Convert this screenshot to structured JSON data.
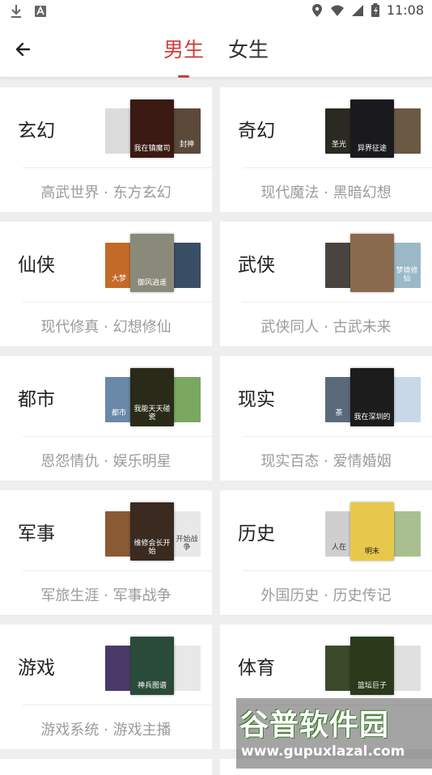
{
  "status_bar": {
    "time": "11:08",
    "left_icons": [
      "download-icon",
      "font-a-icon"
    ],
    "right_icons": [
      "location-icon",
      "wifi-icon",
      "signal-icon",
      "battery-icon"
    ]
  },
  "header": {
    "back_icon": "arrow-left-icon",
    "tabs": [
      {
        "label": "男生",
        "active": true
      },
      {
        "label": "女生",
        "active": false
      }
    ]
  },
  "colors": {
    "accent": "#d23c3c",
    "tag_text": "#9b9b9b",
    "background": "#eeeeee"
  },
  "categories": [
    {
      "name": "玄幻",
      "tags": "高武世界 · 东方玄幻",
      "covers": [
        {
          "text": "",
          "bg": "#dcdcdc"
        },
        {
          "text": "我在镇魔司",
          "bg": "#3a1a12"
        },
        {
          "text": "封神",
          "bg": "#5b4a3a"
        }
      ]
    },
    {
      "name": "奇幻",
      "tags": "现代魔法 · 黑暗幻想",
      "covers": [
        {
          "text": "圣光",
          "bg": "#2b2a22"
        },
        {
          "text": "异界征途",
          "bg": "#1a1a1e"
        },
        {
          "text": "",
          "bg": "#6a5a44"
        }
      ]
    },
    {
      "name": "仙侠",
      "tags": "现代修真 · 幻想修仙",
      "covers": [
        {
          "text": "大梦",
          "bg": "#c46a28"
        },
        {
          "text": "御风逍遥",
          "bg": "#8a8a7a"
        },
        {
          "text": "",
          "bg": "#3a4e66"
        }
      ]
    },
    {
      "name": "武侠",
      "tags": "武侠同人 · 古武未来",
      "covers": [
        {
          "text": "",
          "bg": "#4a4440"
        },
        {
          "text": "",
          "bg": "#8a6a4c"
        },
        {
          "text": "梦境修仙",
          "bg": "#9ab8c8"
        }
      ]
    },
    {
      "name": "都市",
      "tags": "恩怨情仇 · 娱乐明星",
      "covers": [
        {
          "text": "都市",
          "bg": "#6a88a8"
        },
        {
          "text": "我能天天碰瓷",
          "bg": "#2a2a18"
        },
        {
          "text": "",
          "bg": "#7aa860"
        }
      ]
    },
    {
      "name": "现实",
      "tags": "现实百态 · 爱情婚姻",
      "covers": [
        {
          "text": "茶",
          "bg": "#5a6a7a"
        },
        {
          "text": "我在深圳的",
          "bg": "#1c1c1c"
        },
        {
          "text": "",
          "bg": "#c8d8e8"
        }
      ]
    },
    {
      "name": "军事",
      "tags": "军旅生涯 · 军事战争",
      "covers": [
        {
          "text": "",
          "bg": "#8a5a34"
        },
        {
          "text": "维修会长开始",
          "bg": "#3a2a20"
        },
        {
          "text": "开始战争",
          "bg": "#e8e8e8"
        }
      ]
    },
    {
      "name": "历史",
      "tags": "外国历史 · 历史传记",
      "covers": [
        {
          "text": "人在",
          "bg": "#cfcfcf"
        },
        {
          "text": "明末",
          "bg": "#e8c84a"
        },
        {
          "text": "",
          "bg": "#a8c090"
        }
      ]
    },
    {
      "name": "游戏",
      "tags": "游戏系统 · 游戏主播",
      "covers": [
        {
          "text": "",
          "bg": "#4a3a6a"
        },
        {
          "text": "神兵图谱",
          "bg": "#2a4a3a"
        },
        {
          "text": "",
          "bg": "#e8e8e8"
        }
      ]
    },
    {
      "name": "体育",
      "tags": "",
      "covers": [
        {
          "text": "",
          "bg": "#3a4a2a"
        },
        {
          "text": "篮坛巨子",
          "bg": "#2a3a1a"
        },
        {
          "text": "",
          "bg": "#e0e0e0"
        }
      ]
    }
  ],
  "watermark": {
    "title": "谷普软件园",
    "url": "www.gupuxlazal.com"
  }
}
